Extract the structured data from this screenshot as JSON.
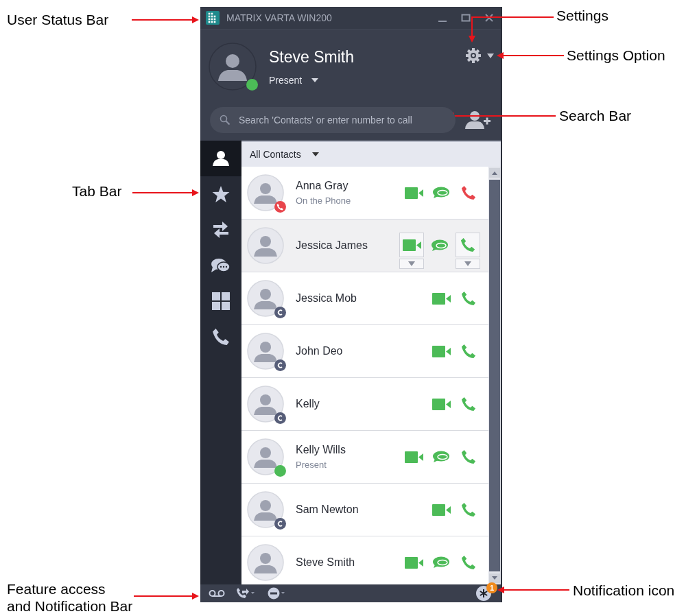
{
  "annotations": [
    {
      "text": "User Status Bar"
    },
    {
      "text": "Tab Bar"
    },
    {
      "text": "Feature access\nand Notification Bar"
    },
    {
      "text": "Settings"
    },
    {
      "text": "Settings Option"
    },
    {
      "text": "Search Bar"
    },
    {
      "text": "Notification icon"
    }
  ],
  "window": {
    "title": "MATRIX VARTA WIN200"
  },
  "user": {
    "name": "Steve Smith",
    "status": "Present",
    "kind": "present"
  },
  "search": {
    "placeholder": "Search 'Contacts' or enter number to call"
  },
  "tabs": [
    {
      "selected": true
    },
    {
      "selected": false
    },
    {
      "selected": false
    },
    {
      "selected": false
    },
    {
      "selected": false
    },
    {
      "selected": false
    }
  ],
  "filter": {
    "label": "All Contacts"
  },
  "contacts": [
    {
      "name": "Anna Gray",
      "status": "On the Phone",
      "kind": "on_phone",
      "chat": true,
      "selected": false
    },
    {
      "name": "Jessica James",
      "kind": "plain",
      "chat": true,
      "selected": true
    },
    {
      "name": "Jessica Mob",
      "kind": "contact",
      "chat": false,
      "selected": false
    },
    {
      "name": "John Deo",
      "kind": "contact",
      "chat": false,
      "selected": false
    },
    {
      "name": "Kelly",
      "kind": "contact",
      "chat": false,
      "selected": false
    },
    {
      "name": "Kelly Wills",
      "status": "Present",
      "kind": "present",
      "chat": true,
      "selected": false
    },
    {
      "name": "Sam Newton",
      "kind": "contact",
      "chat": false,
      "selected": false
    },
    {
      "name": "Steve Smith",
      "kind": "plain",
      "chat": true,
      "selected": false
    }
  ],
  "bottom_bar": {
    "notification_count": "1"
  }
}
